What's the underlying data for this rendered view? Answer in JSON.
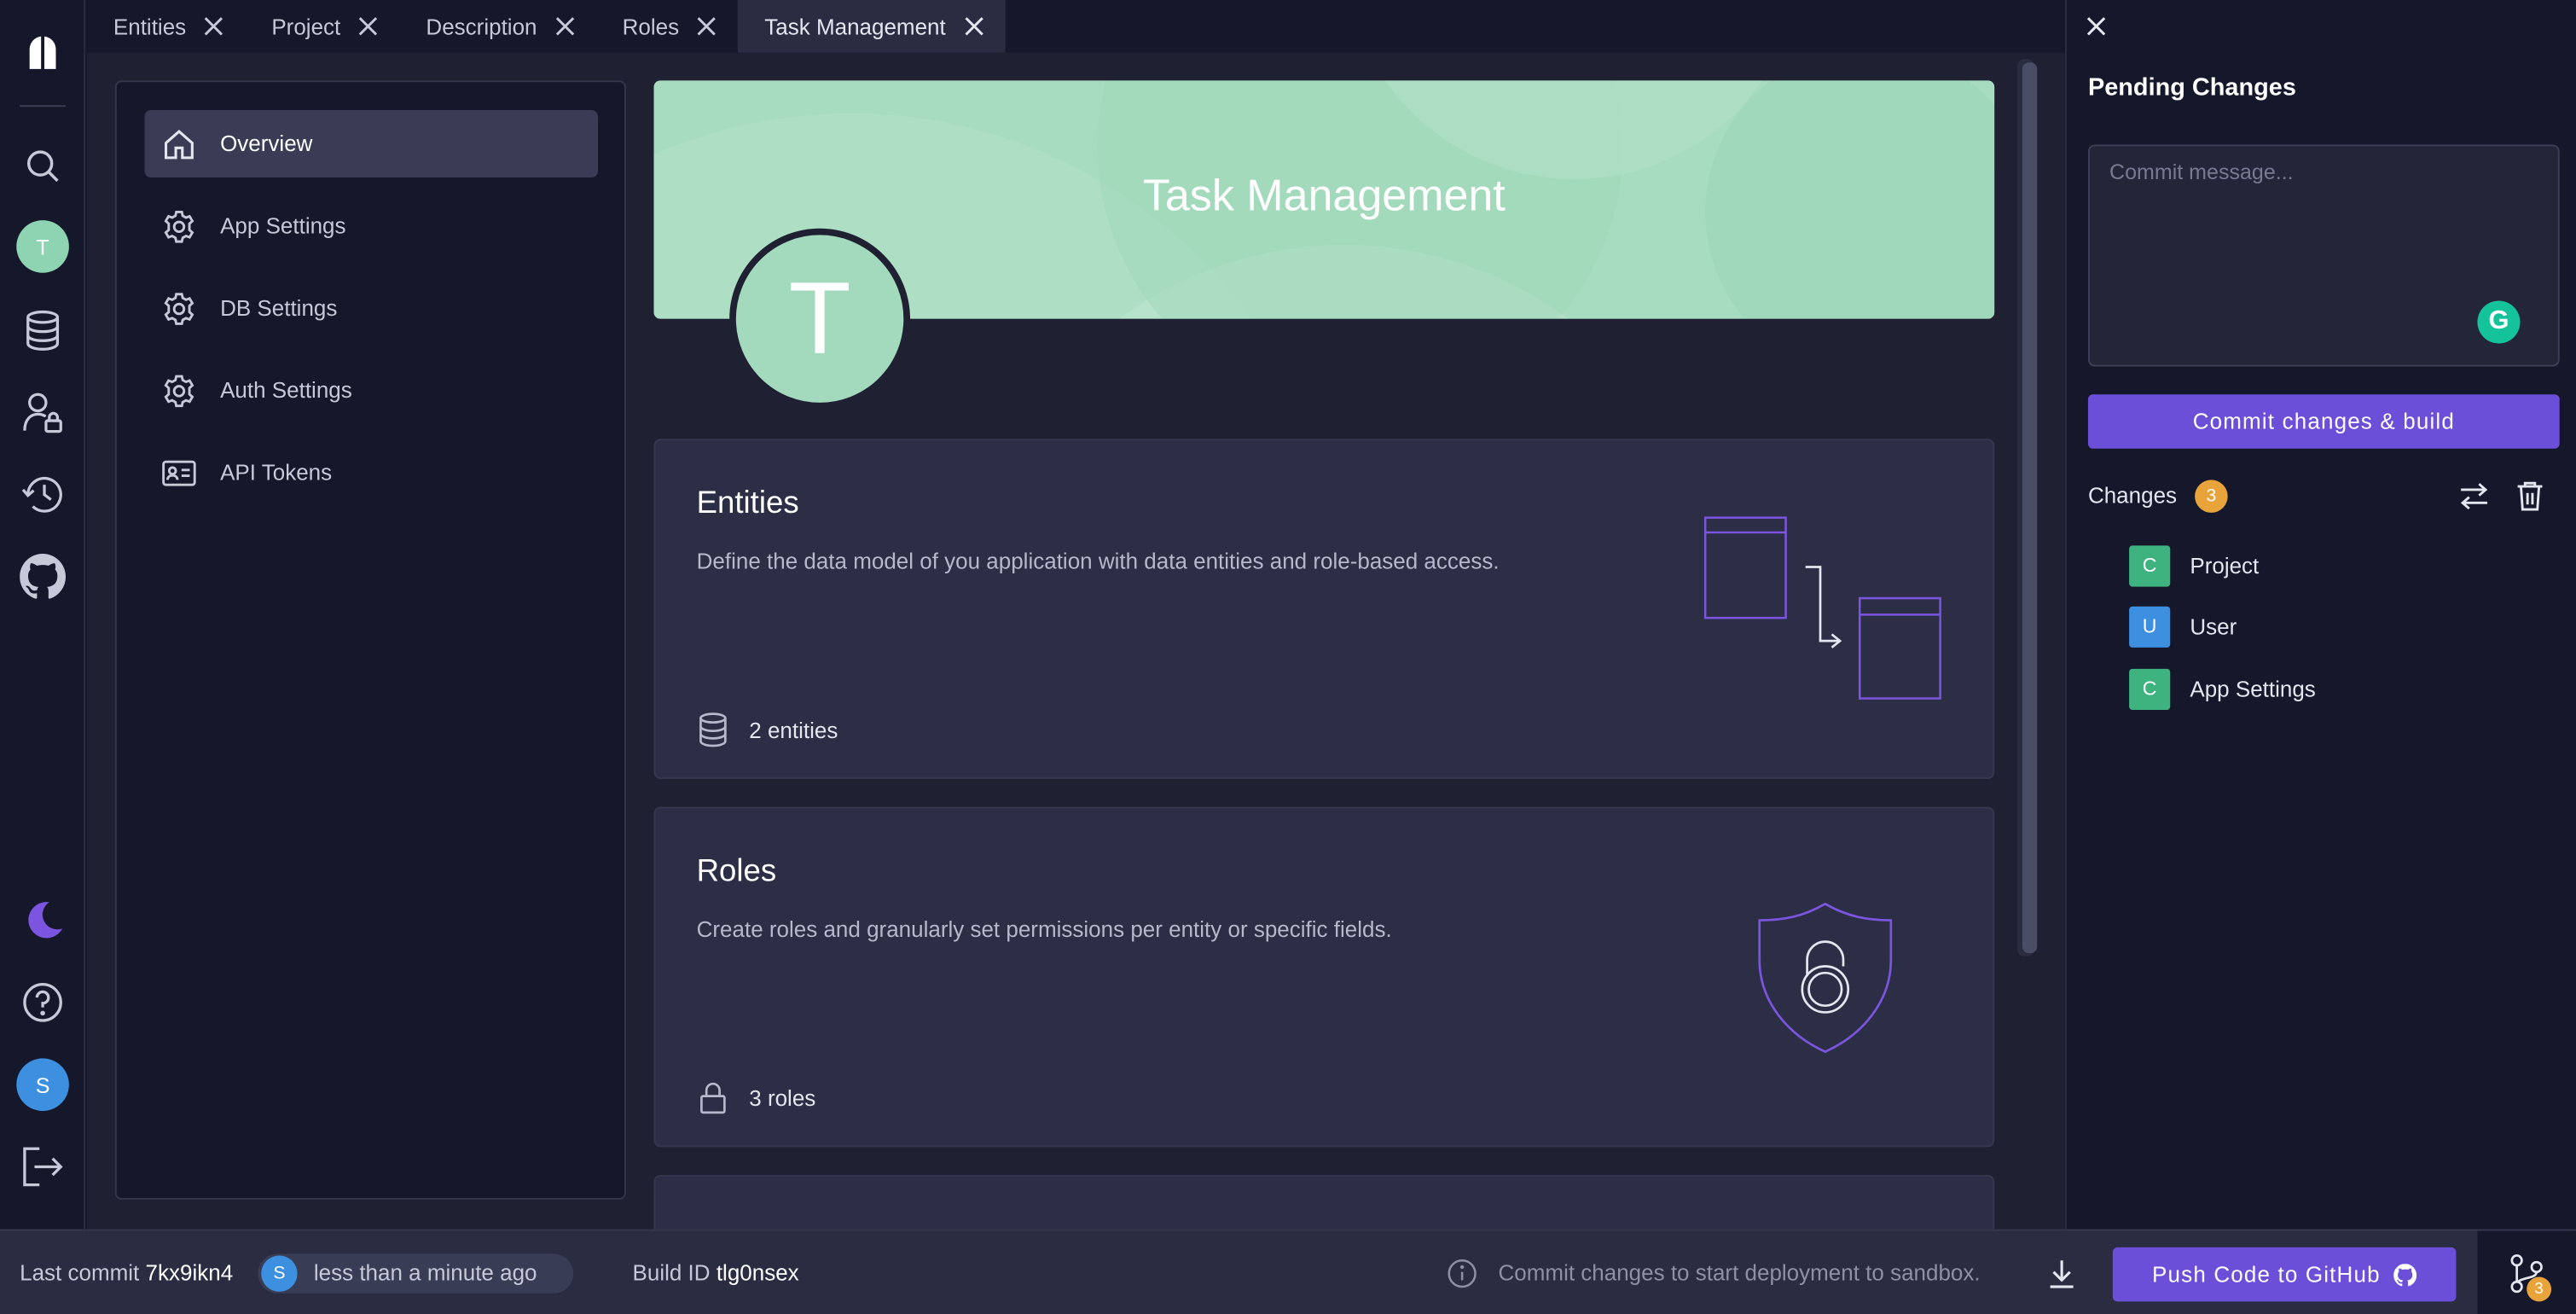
{
  "tabs": [
    {
      "label": "Entities"
    },
    {
      "label": "Project"
    },
    {
      "label": "Description"
    },
    {
      "label": "Roles"
    },
    {
      "label": "Task Management",
      "active": true
    }
  ],
  "rail": {
    "user_initial": "T",
    "account_initial": "S",
    "icons": [
      "logo-icon",
      "search-icon",
      "database-icon",
      "user-lock-icon",
      "history-icon",
      "github-icon",
      "moon-icon",
      "help-icon",
      "logout-icon"
    ]
  },
  "sidenav": {
    "items": [
      {
        "label": "Overview",
        "icon": "home-icon",
        "active": true
      },
      {
        "label": "App Settings",
        "icon": "gear-icon"
      },
      {
        "label": "DB Settings",
        "icon": "gear-icon"
      },
      {
        "label": "Auth Settings",
        "icon": "gear-icon"
      },
      {
        "label": "API Tokens",
        "icon": "id-card-icon"
      }
    ]
  },
  "project": {
    "title": "Task Management",
    "initial": "T",
    "banner_color": "#a8dcc0"
  },
  "cards": [
    {
      "title": "Entities",
      "description": "Define the data model of you application with data entities and role-based access.",
      "meta": "2 entities",
      "meta_icon": "database-icon"
    },
    {
      "title": "Roles",
      "description": "Create roles and granularly set permissions per entity or specific fields.",
      "meta": "3 roles",
      "meta_icon": "lock-icon"
    }
  ],
  "panel": {
    "title": "Pending Changes",
    "commit_placeholder": "Commit message...",
    "commit_button": "Commit changes & build",
    "changes_label": "Changes",
    "changes_count": "3",
    "changes": [
      {
        "type": "C",
        "name": "Project",
        "color": "#3fb37f"
      },
      {
        "type": "U",
        "name": "User",
        "color": "#3d8fe0"
      },
      {
        "type": "C",
        "name": "App Settings",
        "color": "#3fb37f"
      }
    ]
  },
  "footer": {
    "last_commit_label": "Last commit",
    "last_commit_id": "7kx9ikn4",
    "author_initial": "S",
    "commit_time": "less than a minute ago",
    "build_label": "Build ID",
    "build_id": "tlg0nsex",
    "info_text": "Commit changes to start deployment to sandbox.",
    "push_button": "Push Code to GitHub",
    "pending_count": "3"
  },
  "colors": {
    "accent": "#6c4fd8",
    "avatar_green": "#8fd4b2",
    "avatar_blue": "#3d8fe0",
    "badge_orange": "#e8a33a"
  }
}
